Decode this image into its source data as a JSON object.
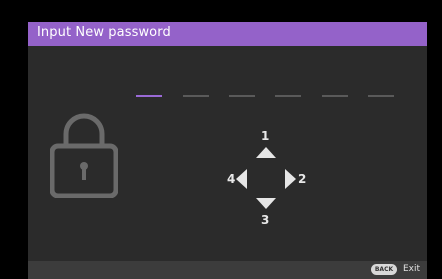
{
  "dialog": {
    "title": "Input New password",
    "accent_color": "#9462c9"
  },
  "password": {
    "total_slots": 6,
    "active_slot": 1
  },
  "keypad": {
    "up_label": "1",
    "right_label": "2",
    "down_label": "3",
    "left_label": "4"
  },
  "footer": {
    "back_label": "BACK",
    "exit_label": "Exit"
  }
}
